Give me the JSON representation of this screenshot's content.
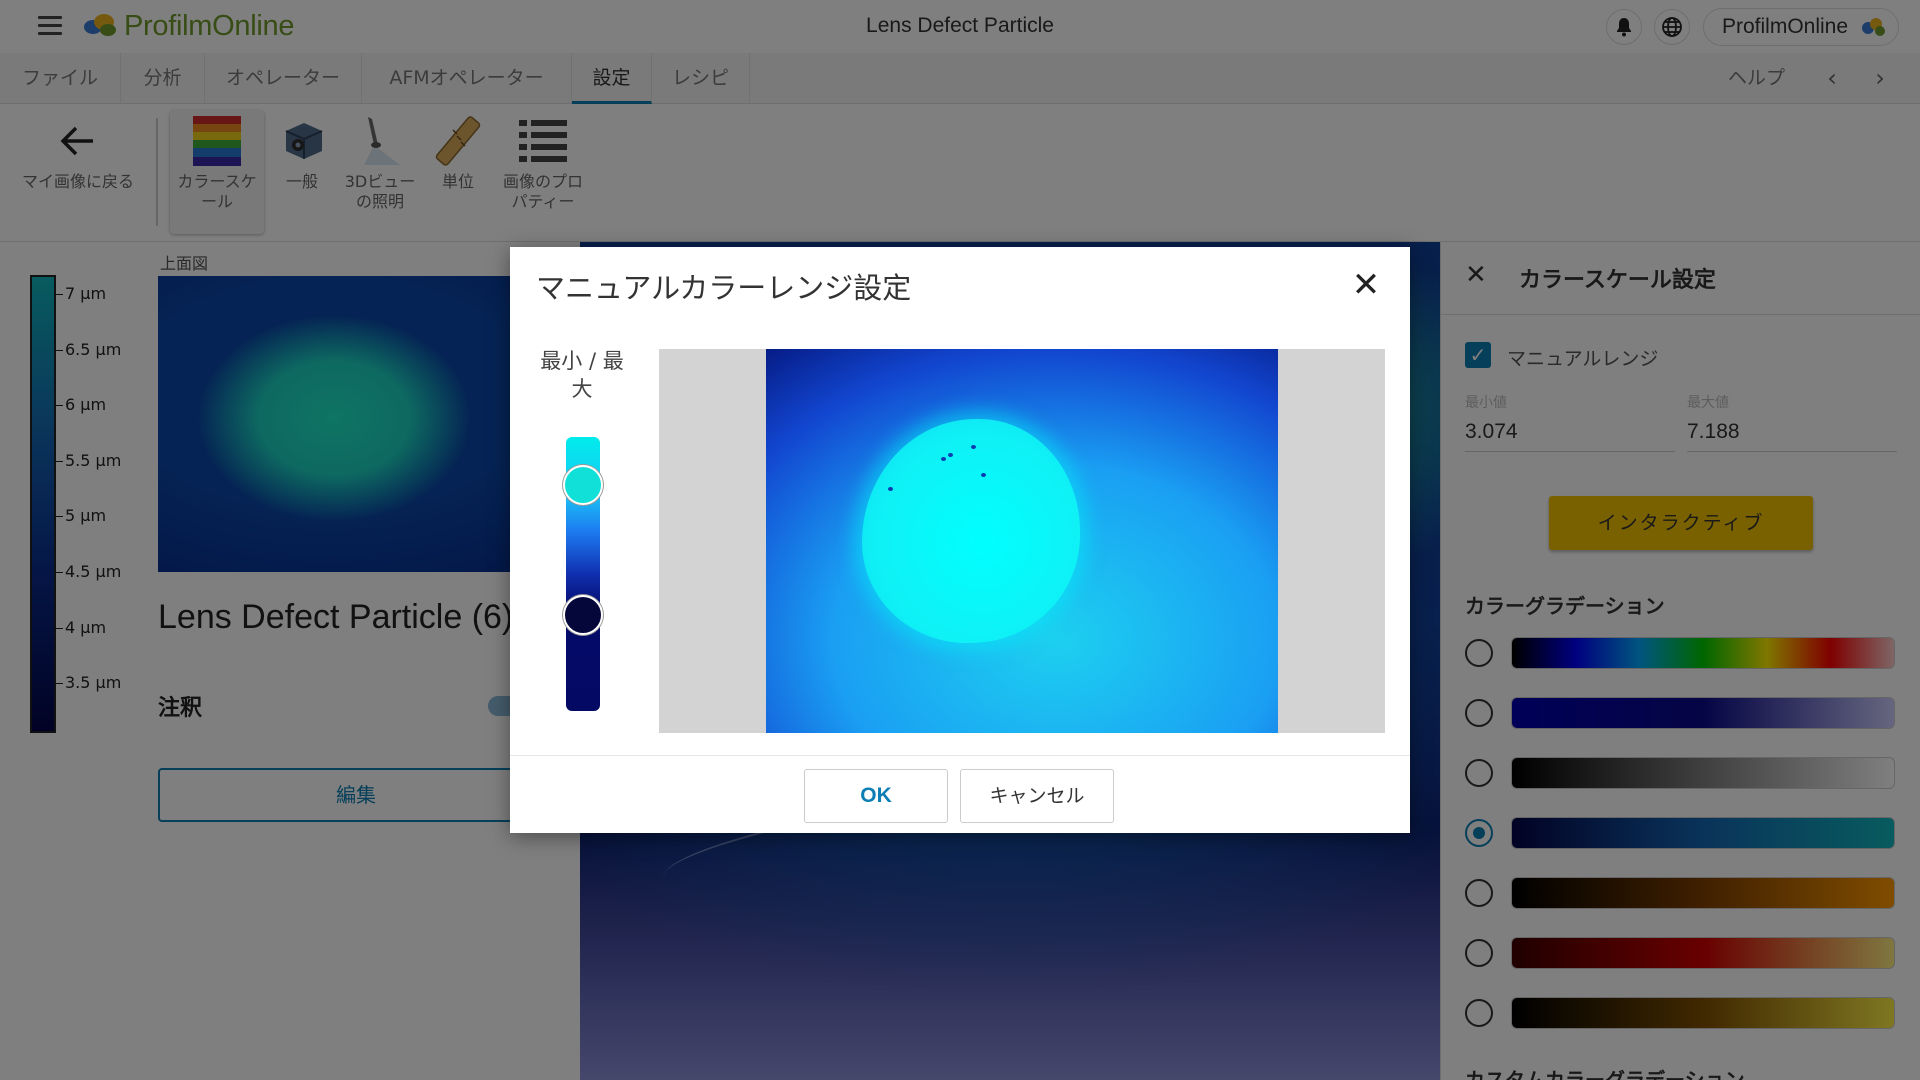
{
  "header": {
    "app_name": "ProfilmOnline",
    "title": "Lens Defect Particle",
    "user_label": "ProfilmOnline",
    "icons": {
      "menu": "hamburger-icon",
      "bell": "bell-icon",
      "globe": "globe-icon"
    }
  },
  "tabs": [
    {
      "label": "ファイル"
    },
    {
      "label": "分析"
    },
    {
      "label": "オペレーター"
    },
    {
      "label": "AFMオペレーター"
    },
    {
      "label": "設定"
    },
    {
      "label": "レシピ"
    }
  ],
  "help_label": "ヘルプ",
  "toolbar": {
    "back_label": "マイ画像に戻る",
    "tools": [
      {
        "label": "カラースケール"
      },
      {
        "label": "一般"
      },
      {
        "label": "3Dビューの照明"
      },
      {
        "label": "単位"
      },
      {
        "label": "画像のプロパティー"
      }
    ]
  },
  "left_panel": {
    "colorbar_ticks": [
      "7 µm",
      "6.5 µm",
      "6 µm",
      "5.5 µm",
      "5 µm",
      "4.5 µm",
      "4 µm",
      "3.5 µm"
    ],
    "view_label": "上面図",
    "image_title": "Lens Defect Particle (6)",
    "note_label": "注釈",
    "edit_button": "編集"
  },
  "right_panel": {
    "title": "カラースケール設定",
    "manual_range_label": "マニュアルレンジ",
    "manual_range_checked": true,
    "min_label": "最小値",
    "max_label": "最大値",
    "min_value": "3.074",
    "max_value": "7.188",
    "interactive_button": "インタラクティブ",
    "gradation_label": "カラーグラデーション",
    "gradations": [
      {
        "name": "rainbow",
        "colors": [
          "#000000",
          "#0000ff",
          "#00aaff",
          "#00cc00",
          "#ffee00",
          "#ff0000",
          "#ffcccc"
        ]
      },
      {
        "name": "blue",
        "colors": [
          "#0000b0",
          "#0a0a8a",
          "#ccccff"
        ]
      },
      {
        "name": "gray",
        "colors": [
          "#000000",
          "#ffffff"
        ]
      },
      {
        "name": "blue-teal",
        "colors": [
          "#03054a",
          "#1467b5",
          "#10b7bd"
        ]
      },
      {
        "name": "orange",
        "colors": [
          "#000000",
          "#804000",
          "#ff9900"
        ]
      },
      {
        "name": "red-yellow",
        "colors": [
          "#400000",
          "#d00000",
          "#ffee80"
        ]
      },
      {
        "name": "brown-yellow",
        "colors": [
          "#000000",
          "#805000",
          "#ffee44"
        ]
      }
    ],
    "selected_gradation_index": 3,
    "custom_gradation_label": "カスタムカラーグラデーション"
  },
  "modal": {
    "title": "マニュアルカラーレンジ設定",
    "minmax_label": "最小 / 最大",
    "ok_label": "OK",
    "cancel_label": "キャンセル",
    "handle_max_color": "#10e0d8",
    "handle_min_color": "#05063a"
  }
}
